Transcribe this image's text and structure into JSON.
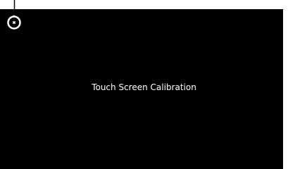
{
  "screen": {
    "title": "Touch Screen Calibration",
    "background_color": "#000000",
    "text_color": "#ffffff"
  },
  "calibration_target": {
    "icon": "crosshair-target-icon",
    "position_label": "top-left",
    "color": "#ffffff"
  }
}
